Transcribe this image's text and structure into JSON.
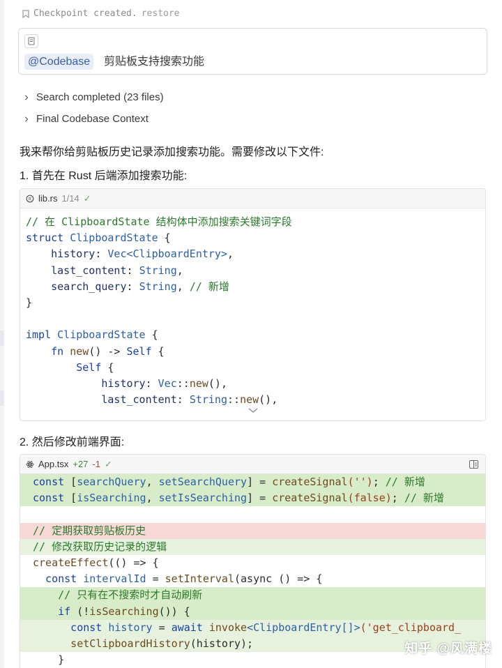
{
  "checkpoint": {
    "text": "Checkpoint created.",
    "restore": "restore"
  },
  "query": {
    "mention": "@Codebase",
    "text": "剪贴板支持搜索功能"
  },
  "collapsed": [
    {
      "label": "Search completed (23 files)"
    },
    {
      "label": "Final Codebase Context"
    }
  ],
  "response": {
    "intro": "我来帮你给剪贴板历史记录添加搜索功能。需要修改以下文件:",
    "step1": "1. 首先在 Rust 后端添加搜索功能:",
    "step2": "2. 然后修改前端界面:"
  },
  "file1": {
    "name": "lib.rs",
    "meta": "1/14"
  },
  "file2": {
    "name": "App.tsx",
    "plus": "+27",
    "minus": "-1"
  },
  "code1": {
    "l1": "// 在 ClipboardState 结构体中添加搜索关键词字段",
    "l2_kw": "struct",
    "l2_ty": " ClipboardState",
    "l2_p": " {",
    "l3_f": "    history",
    "l3_p": ": ",
    "l3_ty": "Vec<ClipboardEntry>",
    "l3_e": ",",
    "l4_f": "    last_content",
    "l4_p": ": ",
    "l4_ty": "String",
    "l4_e": ",",
    "l5_f": "    search_query",
    "l5_p": ": ",
    "l5_ty": "String",
    "l5_e": ", ",
    "l5_c": "// 新增",
    "l6": "}",
    "l8_kw": "impl",
    "l8_ty": " ClipboardState",
    "l8_p": " {",
    "l9_kw": "    fn",
    "l9_fn": " new",
    "l9_p": "() -> ",
    "l9_ty": "Self",
    "l9_e": " {",
    "l10_ty": "        Self",
    "l10_p": " {",
    "l11_f": "            history",
    "l11_p": ": ",
    "l11_ty": "Vec",
    "l11_e": "::",
    "l11_fn": "new",
    "l11_x": "(),",
    "l12_f": "            last_content",
    "l12_p": ": ",
    "l12_ty": "String",
    "l12_e": "::",
    "l12_fn": "new",
    "l12_x": "(),"
  },
  "code2": {
    "a1_kw": "const",
    "a1_p": " [",
    "a1_v": "searchQuery",
    "a1_c": ", ",
    "a1_v2": "setSearchQuery",
    "a1_e": "] = ",
    "a1_fn": "createSignal",
    "a1_s": "('')",
    "a1_x": "; ",
    "a1_cm": "// 新增",
    "a2_kw": "const",
    "a2_p": " [",
    "a2_v": "isSearching",
    "a2_c": ", ",
    "a2_v2": "setIsSearching",
    "a2_e": "] = ",
    "a2_fn": "createSignal",
    "a2_s": "(false)",
    "a2_x": "; ",
    "a2_cm": "// 新增",
    "d1": "// 定期获取剪贴板历史",
    "a3": "// 修改获取历史记录的逻辑",
    "b1_fn": "createEffect",
    "b1_p": "(() => {",
    "b2_kw": "  const",
    "b2_v": " intervalId",
    "b2_p": " = ",
    "b2_fn": "setInterval",
    "b2_e": "(async () => {",
    "b3": "    // 只有在不搜索时才自动刷新",
    "b4_kw": "    if",
    "b4_p": " (!",
    "b4_fn": "isSearching",
    "b4_e": "()) {",
    "b5_kw": "      const",
    "b5_v": " history",
    "b5_p": " = ",
    "b5_kw2": "await",
    "b5_fn": " invoke",
    "b5_ty": "<ClipboardEntry[]>",
    "b5_s": "('get_clipboard_",
    "b6_fn": "      setClipboardHistory",
    "b6_p": "(history);",
    "b7": "    }"
  },
  "watermark": "知乎 @风满楼"
}
